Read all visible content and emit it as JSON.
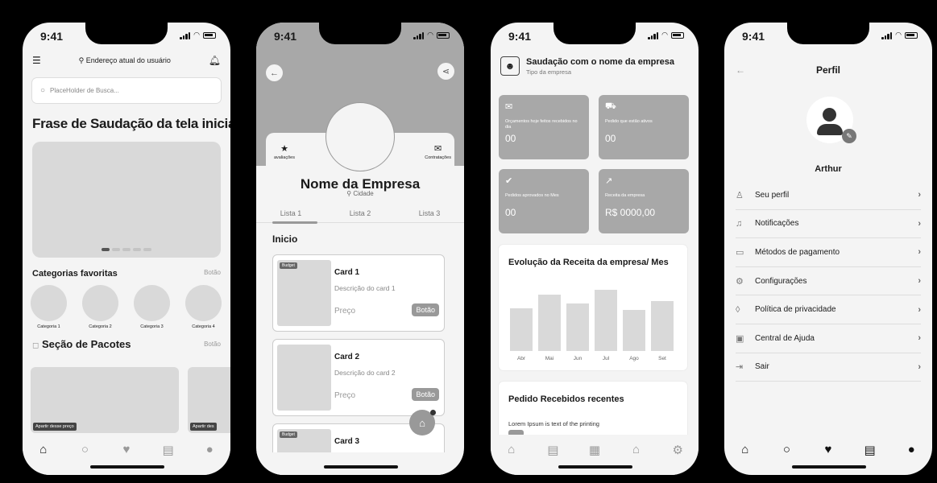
{
  "status": {
    "time": "9:41"
  },
  "screen1": {
    "address": "Endereço atual do usuário",
    "search_placeholder": "PlaceHolder de Busca...",
    "greeting": "Frase de Saudação da tela inicial",
    "categories_title": "Categorias favoritas",
    "categories_button": "Botão",
    "categories": [
      "Categoria 1",
      "Categoria 2",
      "Categoria 3",
      "Categoria 4"
    ],
    "packages_title": "Seção de Pacotes",
    "packages_button": "Botão",
    "package_badge": "Apartir desse preço",
    "package_badge_cut": "Apartir des",
    "icons": {
      "menu": "menu-icon",
      "location": "location-icon",
      "bell": "bell-icon",
      "search": "search-icon"
    }
  },
  "screen2": {
    "ratings_label": "avaliações",
    "hires_label": "Contratações",
    "company_name": "Nome da Empresa",
    "city": "Cidade",
    "tabs": [
      "Lista 1",
      "Lista 2",
      "Lista 3"
    ],
    "section": "Inicio",
    "cards": [
      {
        "badge": "Budget",
        "title": "Card 1",
        "desc": "Descrição do card 1",
        "price": "Preço",
        "button": "Botão"
      },
      {
        "badge": "",
        "title": "Card 2",
        "desc": "Descrição do card 2",
        "price": "Preço",
        "button": "Botão"
      },
      {
        "badge": "Budget",
        "title": "Card 3"
      }
    ]
  },
  "screen3": {
    "greeting": "Saudação com o nome da empresa",
    "company_type": "Tipo da empresa",
    "stats": [
      {
        "label": "Orçamentos hoje feitos recebidos no dia",
        "value": "00"
      },
      {
        "label": "Pedido que estão ativos",
        "value": "00"
      },
      {
        "label": "Pedidos aprovados no Mes",
        "value": "00"
      },
      {
        "label": "Receita da empresa",
        "value": "R$ 0000,00"
      }
    ],
    "chart_title": "Evolução da Receita da empresa/ Mes",
    "recent_title": "Pedido Recebidos recentes",
    "recent_line": "Lorem Ipsum is text of the printing"
  },
  "screen4": {
    "title": "Perfil",
    "user": "Arthur",
    "menu": [
      {
        "label": "Seu perfil",
        "icon": "user-icon"
      },
      {
        "label": "Notificações",
        "icon": "bell-icon"
      },
      {
        "label": "Métodos de pagamento",
        "icon": "card-icon"
      },
      {
        "label": "Configurações",
        "icon": "gear-icon"
      },
      {
        "label": "Política de privacidade",
        "icon": "shield-icon"
      },
      {
        "label": "Central de Ajuda",
        "icon": "help-icon"
      },
      {
        "label": "Sair",
        "icon": "logout-icon"
      }
    ]
  },
  "chart_data": {
    "type": "bar",
    "categories": [
      "Abr",
      "Mai",
      "Jun",
      "Jul",
      "Ago",
      "Set"
    ],
    "values": [
      60,
      80,
      67,
      86,
      58,
      70
    ],
    "title": "Evolução da Receita da empresa/ Mes",
    "ylim": [
      0,
      100
    ],
    "grid": false
  }
}
